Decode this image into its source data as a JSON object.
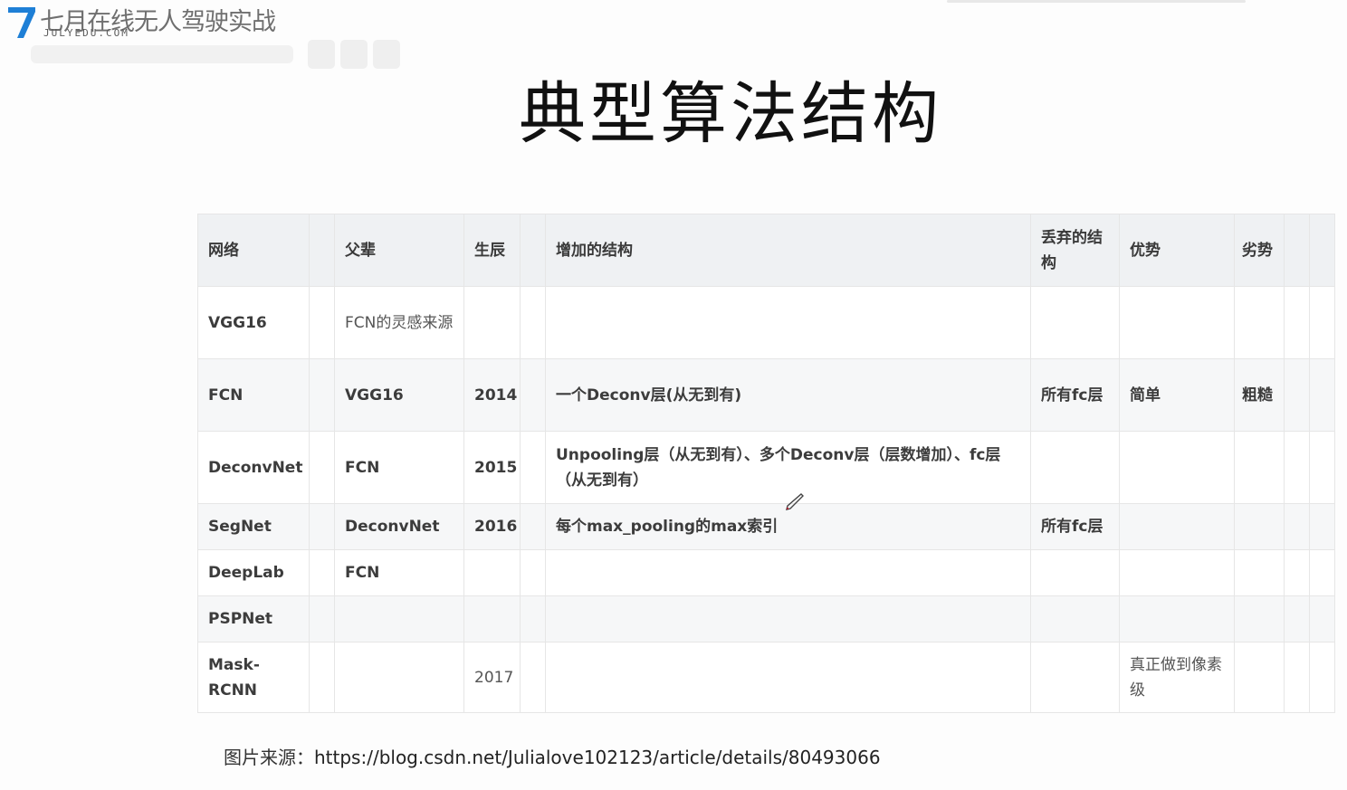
{
  "logo": {
    "cn_text": "七月在线无人驾驶实战",
    "en_text": "JULYEDU.COM",
    "mark_color": "#1e7fd6"
  },
  "slide": {
    "title": "典型算法结构",
    "source_label": "图片来源：",
    "source_url": "https://blog.csdn.net/Julialove102123/article/details/80493066"
  },
  "table": {
    "headers": [
      "网络",
      "父辈",
      "生辰",
      "增加的结构",
      "丢弃的结构",
      "优势",
      "劣势"
    ],
    "rows": [
      {
        "net": "VGG16",
        "parent": "FCN的灵感来源",
        "year": "",
        "added": "",
        "dropped": "",
        "advantage": "",
        "disadvantage": ""
      },
      {
        "net": "FCN",
        "parent": "VGG16",
        "year": "2014",
        "added": "一个Deconv层(从无到有)",
        "dropped": "所有fc层",
        "advantage": "简单",
        "disadvantage": "粗糙"
      },
      {
        "net": "DeconvNet",
        "parent": "FCN",
        "year": "2015",
        "added": "Unpooling层（从无到有）、多个Deconv层（层数增加）、fc层（从无到有）",
        "dropped": "",
        "advantage": "",
        "disadvantage": ""
      },
      {
        "net": "SegNet",
        "parent": "DeconvNet",
        "year": "2016",
        "added": "每个max_pooling的max索引",
        "dropped": "所有fc层",
        "advantage": "",
        "disadvantage": ""
      },
      {
        "net": "DeepLab",
        "parent": "FCN",
        "year": "",
        "added": "",
        "dropped": "",
        "advantage": "",
        "disadvantage": ""
      },
      {
        "net": "PSPNet",
        "parent": "",
        "year": "",
        "added": "",
        "dropped": "",
        "advantage": "",
        "disadvantage": ""
      },
      {
        "net": "Mask-RCNN",
        "parent": "",
        "year": "2017",
        "added": "",
        "dropped": "",
        "advantage": "真正做到像素级",
        "disadvantage": ""
      }
    ]
  }
}
